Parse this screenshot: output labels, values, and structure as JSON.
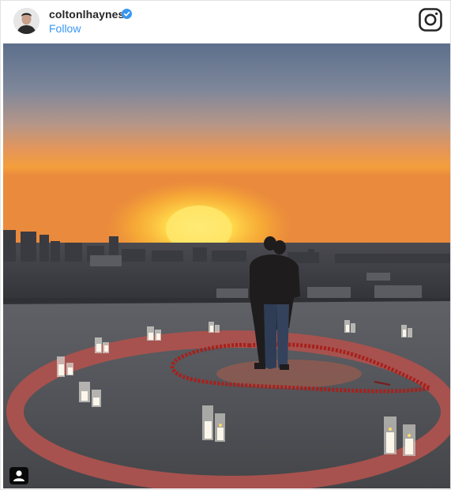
{
  "post": {
    "username": "coltonlhaynes",
    "follow_label": "Follow",
    "verified": true
  },
  "icons": {
    "avatar": "avatar",
    "verified": "verified-badge-icon",
    "instagram": "instagram-logo-icon",
    "tagged_user": "user-tag-icon"
  },
  "colors": {
    "follow": "#3897f0",
    "verified": "#3897f0",
    "text": "#262626"
  }
}
